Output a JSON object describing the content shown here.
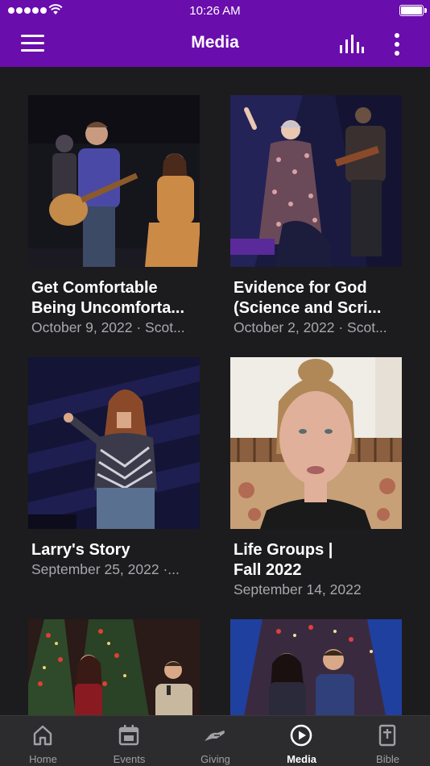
{
  "status_bar": {
    "time": "10:26 AM"
  },
  "header": {
    "title": "Media"
  },
  "media_items": [
    {
      "title_line1": "Get Comfortable",
      "title_line2": "Being Uncomforta...",
      "subtitle": "October 9, 2022 · Scot..."
    },
    {
      "title_line1": "Evidence for God",
      "title_line2": "(Science and Scri...",
      "subtitle": "October 2, 2022 · Scot..."
    },
    {
      "title_line1": "Larry's Story",
      "subtitle": "September 25, 2022 ·..."
    },
    {
      "title_line1": "Life Groups |",
      "title_line2": "Fall 2022",
      "subtitle": "September 14, 2022"
    }
  ],
  "tabs": [
    {
      "label": "Home",
      "icon": "home-icon"
    },
    {
      "label": "Events",
      "icon": "calendar-icon"
    },
    {
      "label": "Giving",
      "icon": "giving-hand-icon"
    },
    {
      "label": "Media",
      "icon": "play-circle-icon",
      "active": true
    },
    {
      "label": "Bible",
      "icon": "bible-icon"
    }
  ],
  "colors": {
    "brand": "#6a0dad",
    "background": "#1c1c1e",
    "tab_bar": "#2c2c2e",
    "subtitle": "#a8a8ad"
  }
}
